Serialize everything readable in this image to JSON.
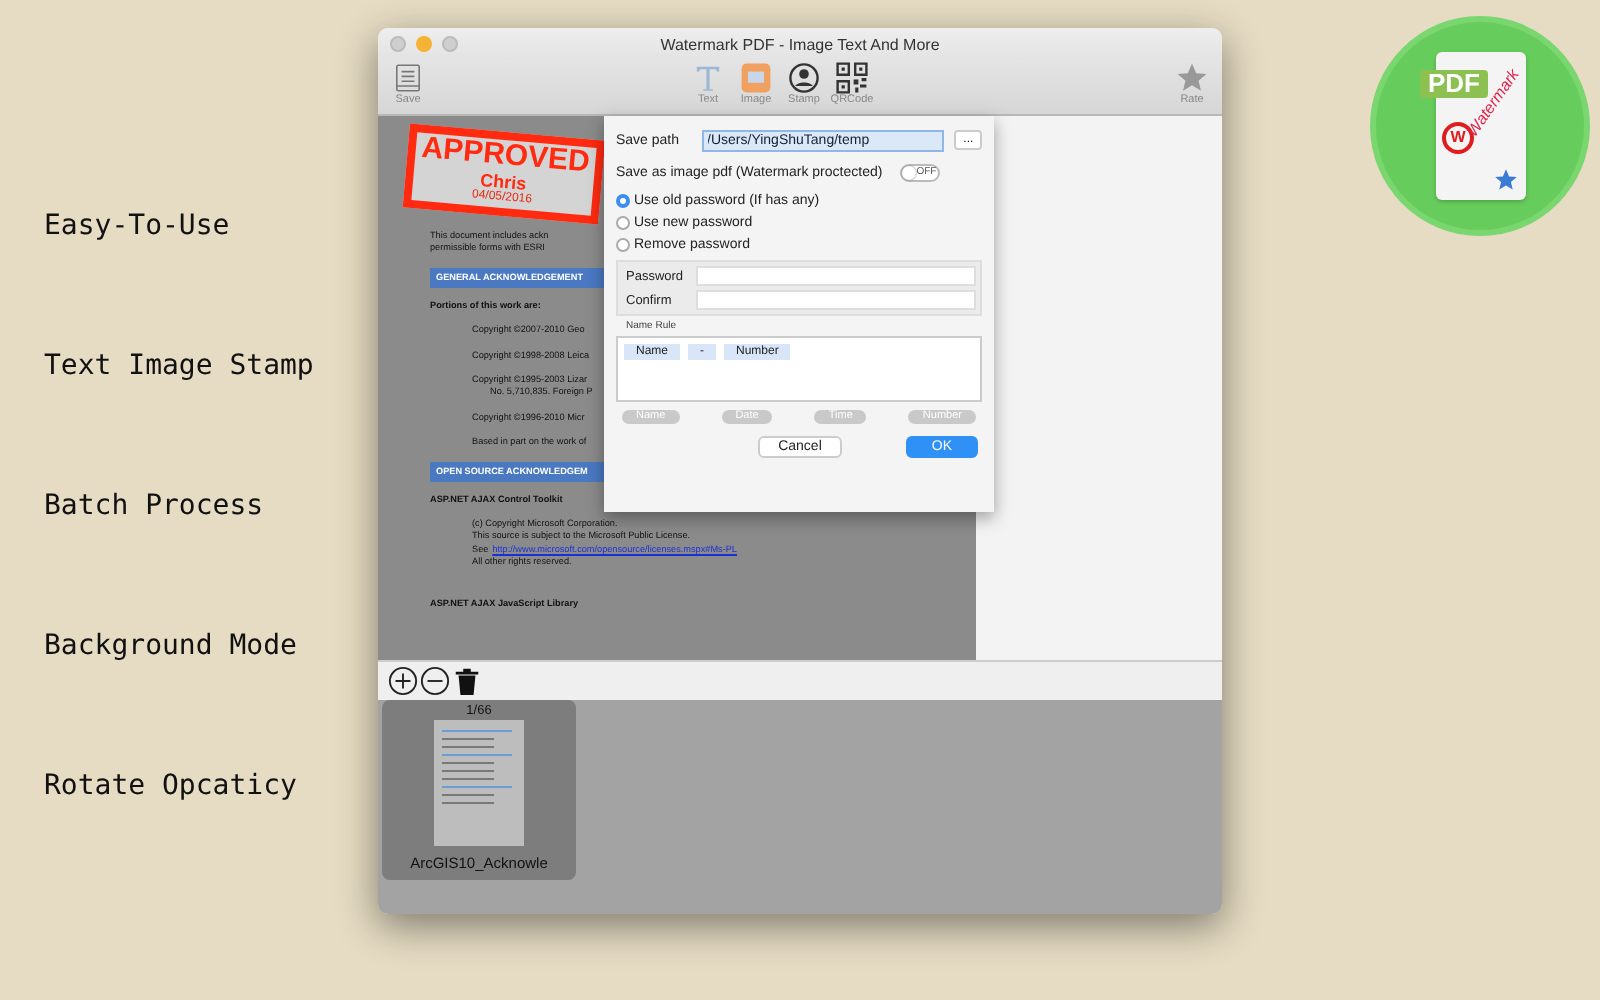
{
  "features": [
    "Easy-To-Use",
    "Text Image Stamp",
    "Batch Process",
    "Background Mode",
    "Rotate Opcaticy"
  ],
  "window": {
    "title": "Watermark PDF - Image Text And More",
    "toolbar": [
      {
        "kind": "save",
        "label": "Save"
      },
      {
        "kind": "text",
        "label": "Text"
      },
      {
        "kind": "image",
        "label": "Image"
      },
      {
        "kind": "stamp",
        "label": "Stamp"
      },
      {
        "kind": "qrcode",
        "label": "QRCode"
      },
      {
        "kind": "rate",
        "label": "Rate"
      }
    ]
  },
  "document": {
    "stamp": {
      "title": "APPROVED",
      "name": "Chris",
      "date": "04/05/2016"
    },
    "blocks": [
      {
        "kind": "para",
        "text": "This document includes ackn"
      },
      {
        "kind": "para",
        "text": "permissible forms with ESRI"
      },
      {
        "kind": "heading",
        "text": "GENERAL ACKNOWLEDGEMENT"
      },
      {
        "kind": "bold",
        "text": "Portions of this work are:"
      },
      {
        "kind": "indent",
        "text": "Copyright ©2007-2010 Geo"
      },
      {
        "kind": "indent",
        "text": "Copyright ©1998-2008 Leica"
      },
      {
        "kind": "indent",
        "text": "Copyright ©1995-2003 Lizar"
      },
      {
        "kind": "indent2",
        "text": "No. 5,710,835. Foreign P"
      },
      {
        "kind": "indent",
        "text": "Copyright ©1996-2010 Micr"
      },
      {
        "kind": "indent",
        "text": "Based in part on the work of"
      },
      {
        "kind": "heading",
        "text": "OPEN SOURCE ACKNOWLEDGEM"
      },
      {
        "kind": "bold",
        "text": "ASP.NET AJAX Control Toolkit"
      },
      {
        "kind": "indent",
        "text": "(c) Copyright Microsoft Corporation."
      },
      {
        "kind": "indent",
        "text": "This source is subject to the Microsoft Public License."
      },
      {
        "kind": "link",
        "prefix": "See",
        "text": "http://www.microsoft.com/opensource/licenses.mspx#Ms-PL"
      },
      {
        "kind": "indent",
        "text": "All other rights reserved."
      },
      {
        "kind": "bold",
        "text": "ASP.NET AJAX JavaScript Library"
      }
    ]
  },
  "dialog": {
    "save_path_label": "Save path",
    "save_path": "/Users/YingShuTang/temp",
    "browse": "...",
    "image_pdf_label": "Save as image pdf (Watermark proctected)",
    "image_pdf": {
      "on": false,
      "label": "OFF"
    },
    "password_options": [
      {
        "label": "Use old password (If has any)",
        "selected": true
      },
      {
        "label": "Use new password",
        "selected": false
      },
      {
        "label": "Remove password",
        "selected": false
      }
    ],
    "password_label": "Password",
    "confirm_label": "Confirm",
    "name_rule_label": "Name Rule",
    "name_rule": [
      "Name",
      "-",
      "Number"
    ],
    "tokens": [
      "Name",
      "Date",
      "Time",
      "Number"
    ],
    "buttons": [
      {
        "kind": "cancel",
        "label": "Cancel"
      },
      {
        "kind": "ok",
        "label": "OK"
      }
    ]
  },
  "pages": {
    "counter": "1/66",
    "thumbnail_caption": "ArcGIS10_Acknowle"
  },
  "app_icon": {
    "badge": "PDF",
    "letter": "W",
    "text": "Watermark"
  }
}
